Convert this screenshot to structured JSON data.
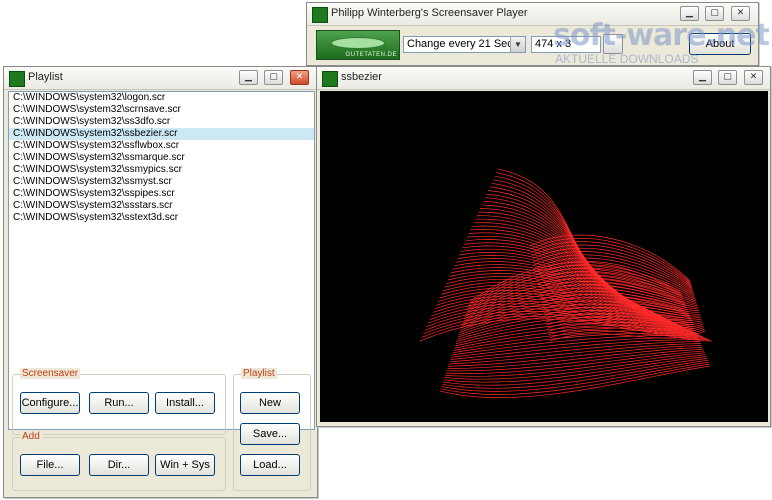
{
  "player": {
    "title": "Philipp Winterberg's Screensaver Player",
    "logo_text": "GUTETATEN.DE",
    "interval_select": "Change every 21 Sec.",
    "size_select": "474 x 3",
    "about_button": "About"
  },
  "playlist_window": {
    "title": "Playlist",
    "items": [
      {
        "label": "C:\\WINDOWS\\system32\\logon.scr",
        "selected": false
      },
      {
        "label": "C:\\WINDOWS\\system32\\scrnsave.scr",
        "selected": false
      },
      {
        "label": "C:\\WINDOWS\\system32\\ss3dfo.scr",
        "selected": false
      },
      {
        "label": "C:\\WINDOWS\\system32\\ssbezier.scr",
        "selected": true
      },
      {
        "label": "C:\\WINDOWS\\system32\\ssflwbox.scr",
        "selected": false
      },
      {
        "label": "C:\\WINDOWS\\system32\\ssmarque.scr",
        "selected": false
      },
      {
        "label": "C:\\WINDOWS\\system32\\ssmypics.scr",
        "selected": false
      },
      {
        "label": "C:\\WINDOWS\\system32\\ssmyst.scr",
        "selected": false
      },
      {
        "label": "C:\\WINDOWS\\system32\\sspipes.scr",
        "selected": false
      },
      {
        "label": "C:\\WINDOWS\\system32\\ssstars.scr",
        "selected": false
      },
      {
        "label": "C:\\WINDOWS\\system32\\sstext3d.scr",
        "selected": false
      }
    ],
    "screensaver_group": {
      "label": "Screensaver",
      "configure": "Configure...",
      "run": "Run...",
      "install": "Install..."
    },
    "add_group": {
      "label": "Add",
      "file": "File...",
      "dir": "Dir...",
      "win_sys": "Win + Sys"
    },
    "playlist_group": {
      "label": "Playlist",
      "new": "New",
      "save": "Save...",
      "load": "Load..."
    }
  },
  "preview_window": {
    "title": "ssbezier",
    "canvas_color": "#000000",
    "line_color": "#ff2a2a"
  },
  "watermark": {
    "main": "soft-ware.net",
    "sub": "AKTUELLE DOWNLOADS"
  },
  "colors": {
    "window_face": "#ece9d8",
    "selection": "#cde8f5",
    "group_label": "#c63c12",
    "app_icon": "#1f7a1f"
  }
}
